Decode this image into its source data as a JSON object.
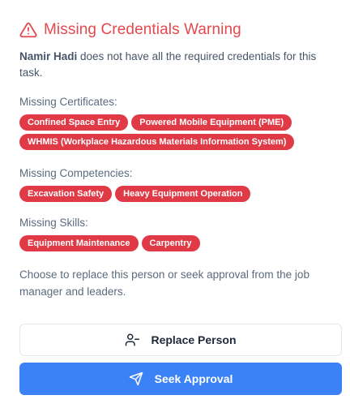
{
  "dialog": {
    "title": "Missing Credentials Warning",
    "person_name": "Namir Hadi",
    "intro_text": " does not have all the required credentials for this task.",
    "help_text": "Choose to replace this person or seek approval from the job manager and leaders."
  },
  "sections": {
    "certificates": {
      "label": "Missing Certificates:",
      "items": [
        "Confined Space Entry",
        "Powered Mobile Equipment (PME)",
        "WHMIS (Workplace Hazardous Materials Information System)"
      ]
    },
    "competencies": {
      "label": "Missing Competencies:",
      "items": [
        "Excavation Safety",
        "Heavy Equipment Operation"
      ]
    },
    "skills": {
      "label": "Missing Skills:",
      "items": [
        "Equipment Maintenance",
        "Carpentry"
      ]
    }
  },
  "actions": {
    "replace_label": "Replace Person",
    "approve_label": "Seek Approval"
  },
  "colors": {
    "warning": "#e5484d",
    "badge": "#e03a47",
    "primary": "#3b82f6"
  },
  "icons": {
    "title": "alert-triangle-icon",
    "replace": "user-minus-icon",
    "approve": "send-icon"
  }
}
